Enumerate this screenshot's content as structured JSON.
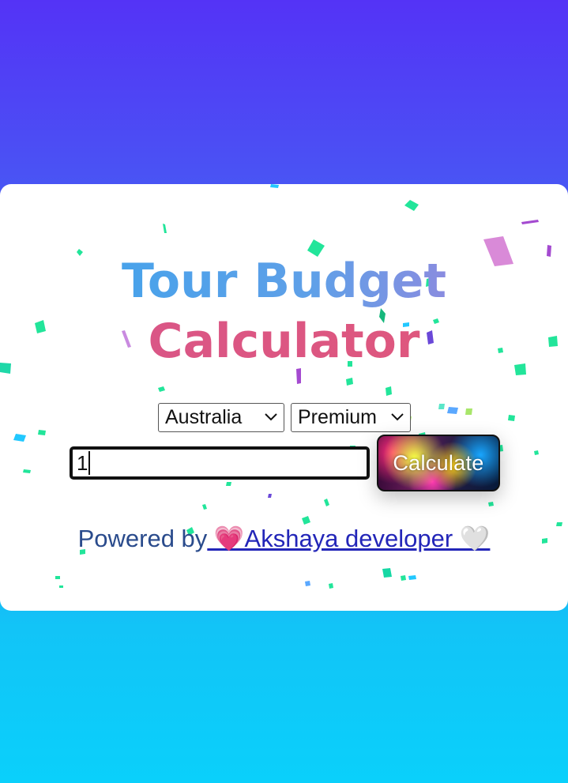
{
  "colors": {
    "title_line1": "#4aa2ea",
    "title_line2": "#dd5880",
    "background_top": "#5433f6",
    "background_bottom": "#0ad0fb",
    "link": "#2326b8"
  },
  "title": {
    "line1": "Tour Budget",
    "line2": "Calculator"
  },
  "form": {
    "country_select": {
      "value": "Australia",
      "icon": "chevron-down-icon"
    },
    "plan_select": {
      "value": "Premium",
      "icon": "chevron-down-icon"
    },
    "travelers_input": {
      "value": "1"
    },
    "calculate_button": "Calculate"
  },
  "footer": {
    "powered_prefix": "Powered by",
    "link_text": " 💗Akshaya developer 🤍"
  }
}
